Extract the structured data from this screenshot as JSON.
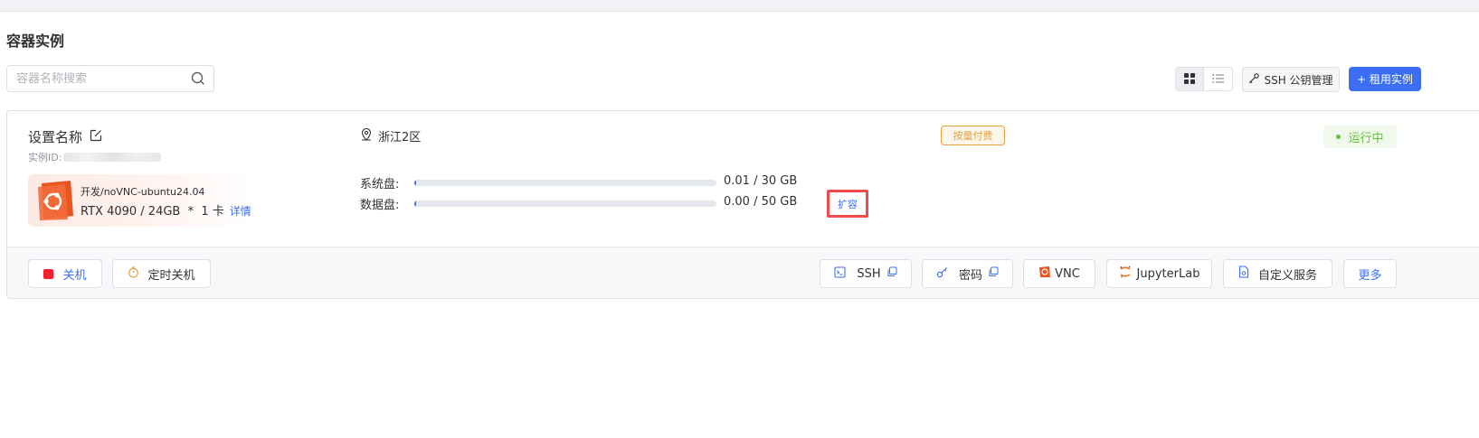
{
  "page": {
    "title": "容器实例"
  },
  "search": {
    "placeholder": "容器名称搜索"
  },
  "toolbar": {
    "ssh_key_label": "SSH 公钥管理",
    "rent_label": "+ 租用实例"
  },
  "instance": {
    "name": "设置名称",
    "id_label": "实例ID:",
    "region": "浙江2区",
    "billing": "按量付费",
    "status": "运行中",
    "image": {
      "name": "开发/noVNC-ubuntu24.04",
      "gpu": "RTX 4090 / 24GB  *  1 卡",
      "details_label": "详情"
    },
    "system_disk": {
      "label": "系统盘:",
      "value": "0.01 / 30 GB",
      "used_fraction": 0.0003
    },
    "data_disk": {
      "label": "数据盘:",
      "value": "0.00 / 50 GB",
      "used_fraction": 0.0
    },
    "expand_label": "扩容"
  },
  "actions": {
    "shutdown": "关机",
    "scheduled_shutdown": "定时关机",
    "ssh": "SSH",
    "password": "密码",
    "vnc": "VNC",
    "jupyter": "JupyterLab",
    "custom_service": "自定义服务",
    "more": "更多"
  },
  "colors": {
    "primary": "#3b6ef5",
    "running": "#67c23a",
    "billing": "#e6a23c",
    "danger": "#f5222d",
    "ubuntu_orange": "#e95420"
  },
  "icons": {
    "search": "search-icon",
    "grid_view": "grid-icon",
    "list_view": "list-icon",
    "key": "key-icon",
    "edit": "edit-icon",
    "location": "location-icon",
    "copy": "copy-icon",
    "timer": "timer-icon",
    "terminal": "terminal-icon",
    "file": "file-icon"
  }
}
